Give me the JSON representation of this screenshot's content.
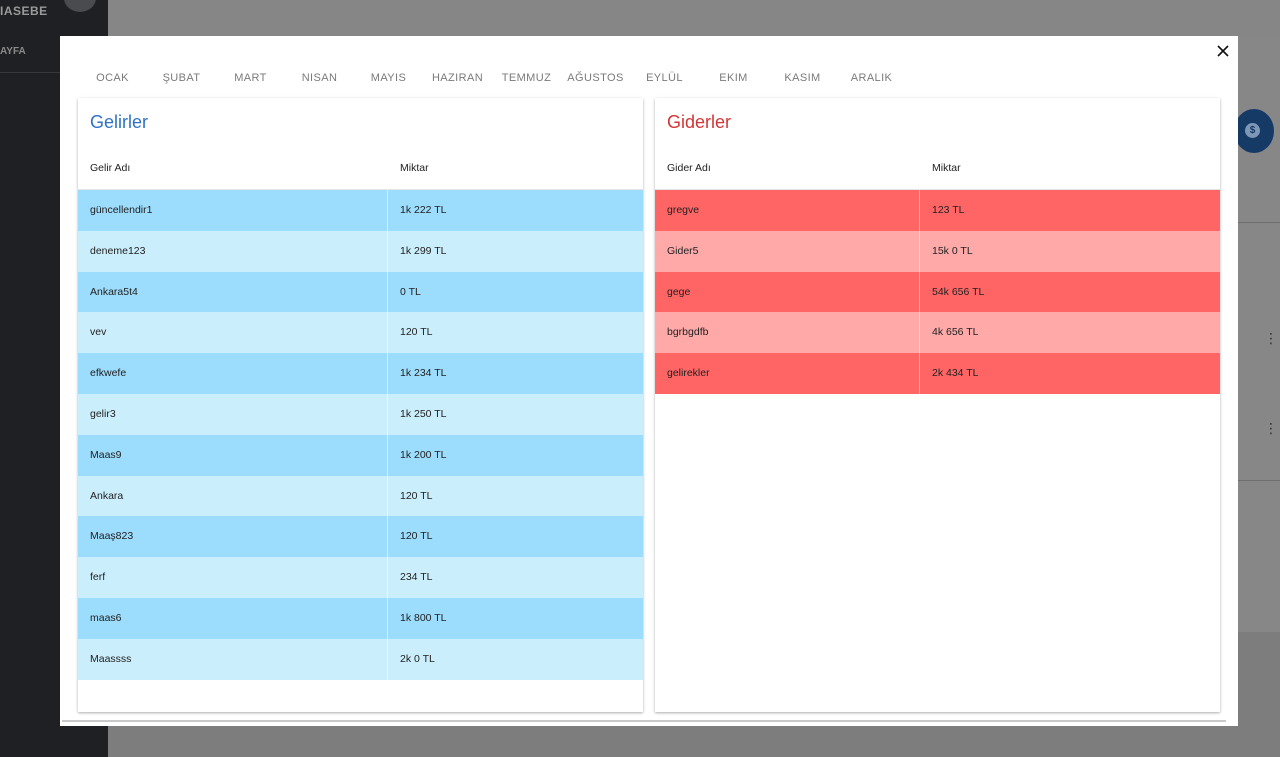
{
  "background": {
    "brand": "IASEBE",
    "nav_item": "AYFA",
    "fab_symbol": "$",
    "more_symbol": "⋮"
  },
  "modal": {
    "close_symbol": "×",
    "months": [
      "OCAK",
      "ŞUBAT",
      "MART",
      "NISAN",
      "MAYIS",
      "HAZIRAN",
      "TEMMUZ",
      "AĞUSTOS",
      "EYLÜL",
      "EKIM",
      "KASIM",
      "ARALIK"
    ],
    "income": {
      "title": "Gelirler",
      "col_name": "Gelir Adı",
      "col_amount": "Miktar",
      "rows": [
        {
          "name": "güncellendir1",
          "amount": "1k 222 TL"
        },
        {
          "name": "deneme123",
          "amount": "1k 299 TL"
        },
        {
          "name": "Ankara5t4",
          "amount": "0 TL"
        },
        {
          "name": "vev",
          "amount": "120 TL"
        },
        {
          "name": "efkwefe",
          "amount": "1k 234 TL"
        },
        {
          "name": "gelir3",
          "amount": "1k 250 TL"
        },
        {
          "name": "Maas9",
          "amount": "1k 200 TL"
        },
        {
          "name": "Ankara",
          "amount": "120 TL"
        },
        {
          "name": "Maaş823",
          "amount": "120 TL"
        },
        {
          "name": "ferf",
          "amount": "234 TL"
        },
        {
          "name": "maas6",
          "amount": "1k 800 TL"
        },
        {
          "name": "Maassss",
          "amount": "2k 0 TL"
        }
      ]
    },
    "expense": {
      "title": "Giderler",
      "col_name": "Gider Adı",
      "col_amount": "Miktar",
      "rows": [
        {
          "name": "gregve",
          "amount": "123 TL"
        },
        {
          "name": "Gider5",
          "amount": "15k 0 TL"
        },
        {
          "name": "gege",
          "amount": "54k 656 TL"
        },
        {
          "name": "bgrbgdfb",
          "amount": "4k 656 TL"
        },
        {
          "name": "gelirekler",
          "amount": "2k 434 TL"
        }
      ]
    }
  },
  "colors": {
    "income_title": "#2f73c5",
    "expense_title": "#d43535",
    "income_row_dark": "#9cdcfc",
    "income_row_light": "#cbeefc",
    "expense_row_dark": "#ff6565",
    "expense_row_light": "#ffa9a9"
  }
}
